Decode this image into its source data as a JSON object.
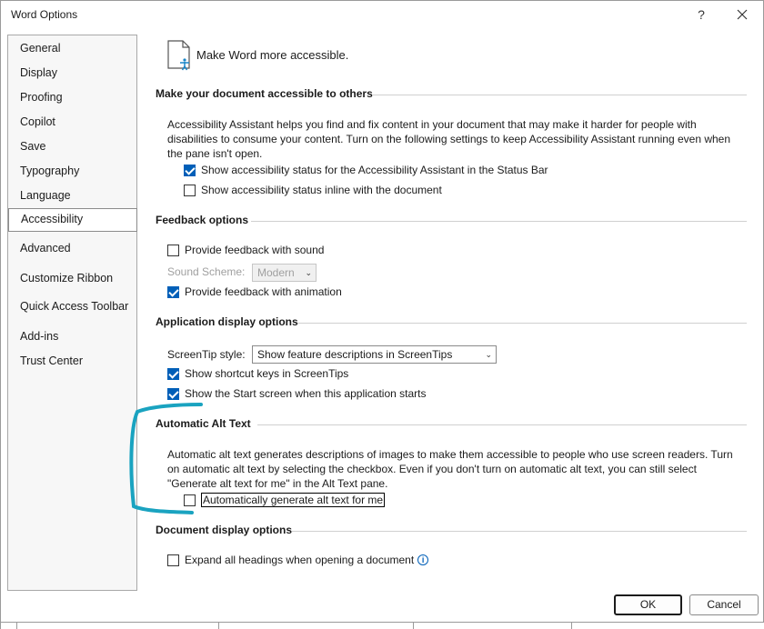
{
  "window": {
    "title": "Word Options",
    "help_glyph": "?",
    "close_glyph": "✕"
  },
  "sidebar": {
    "items": [
      {
        "label": "General"
      },
      {
        "label": "Display"
      },
      {
        "label": "Proofing"
      },
      {
        "label": "Copilot"
      },
      {
        "label": "Save"
      },
      {
        "label": "Typography"
      },
      {
        "label": "Language"
      },
      {
        "label": "Accessibility",
        "active": true
      },
      {
        "label": "Advanced"
      },
      {
        "label": "Customize Ribbon"
      },
      {
        "label": "Quick Access Toolbar"
      },
      {
        "label": "Add-ins"
      },
      {
        "label": "Trust Center"
      }
    ]
  },
  "header": {
    "text": "Make Word more accessible.",
    "icon": "accessibility-document-icon"
  },
  "sections": {
    "accessible": {
      "title": "Make your document accessible to others",
      "description": "Accessibility Assistant helps you find and fix content in your document that may make it harder for people with disabilities to consume your content. Turn on the following settings to keep Accessibility Assistant running even when the pane isn't open.",
      "opt_status_bar": {
        "label": "Show accessibility status for the Accessibility Assistant in the Status Bar",
        "checked": true
      },
      "opt_inline": {
        "label": "Show accessibility status inline with the document",
        "checked": false
      }
    },
    "feedback": {
      "title": "Feedback options",
      "opt_sound": {
        "label": "Provide feedback with sound",
        "checked": false
      },
      "sound_scheme_label": "Sound Scheme:",
      "sound_scheme_value": "Modern",
      "opt_animation": {
        "label": "Provide feedback with animation",
        "checked": true
      }
    },
    "app_display": {
      "title": "Application display options",
      "screentip_label": "ScreenTip style:",
      "screentip_value": "Show feature descriptions in ScreenTips",
      "opt_shortcuts": {
        "label": "Show shortcut keys in ScreenTips",
        "checked": true
      },
      "opt_start": {
        "label": "Show the Start screen when this application starts",
        "checked": true
      }
    },
    "alt_text": {
      "title": "Automatic Alt Text",
      "description": "Automatic alt text generates descriptions of images to make them accessible to people who use screen readers. Turn on automatic alt text by selecting the checkbox. Even if you don't turn on automatic alt text, you can still select \"Generate alt text for me\" in the Alt Text pane.",
      "opt_generate": {
        "label": "Automatically generate alt text for me",
        "checked": false
      }
    },
    "doc_display": {
      "title": "Document display options",
      "opt_expand": {
        "label": "Expand all headings when opening a document",
        "checked": false
      },
      "info_glyph": "i"
    }
  },
  "footer": {
    "ok_label": "OK",
    "cancel_label": "Cancel"
  },
  "colors": {
    "accent": "#005fb8",
    "annotation": "#1aa3c0"
  }
}
